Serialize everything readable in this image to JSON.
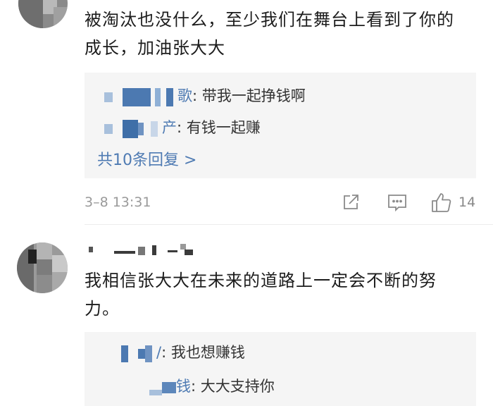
{
  "comments": [
    {
      "text": "被淘汰也没什么，至少我们在舞台上看到了你的成长，加油张大大",
      "replies": [
        {
          "user": "歌",
          "text": ": 带我一起挣钱啊"
        },
        {
          "user": "产",
          "text": ": 有钱一起赚"
        }
      ],
      "more_replies": "共10条回复 >",
      "timestamp": "3–8 13:31",
      "likes": "14"
    },
    {
      "text": "我相信张大大在未来的道路上一定会不断的努力。",
      "replies": [
        {
          "user": "/",
          "text": ": 我也想赚钱"
        },
        {
          "user": "钱",
          "text": ": 大大支持你"
        }
      ]
    }
  ],
  "icons": {
    "share": "share-icon",
    "comment": "comment-icon",
    "like": "thumbs-up-icon"
  },
  "colors": {
    "link": "#4f7bb3",
    "reply_bg": "#f5f5f5",
    "meta": "#9a9a9a"
  }
}
